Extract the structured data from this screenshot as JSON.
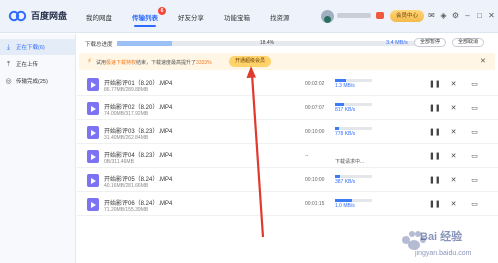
{
  "app": {
    "name": "百度网盘"
  },
  "nav": {
    "tabs": [
      {
        "label": "我的网盘"
      },
      {
        "label": "传输列表",
        "badge": "6"
      },
      {
        "label": "好友分享"
      },
      {
        "label": "功能宝箱"
      },
      {
        "label": "找资源"
      }
    ]
  },
  "header": {
    "vip_button": "会员中心",
    "icons": [
      "mail-icon",
      "skin-icon",
      "settings-icon",
      "minimize-icon",
      "maximize-icon",
      "close-icon"
    ]
  },
  "sidebar": {
    "items": [
      {
        "label": "正在下载(6)",
        "icon": "download-icon",
        "active": true
      },
      {
        "label": "正在上传",
        "icon": "upload-icon",
        "active": false
      },
      {
        "label": "传输完成(25)",
        "icon": "check-circle-icon",
        "active": false
      }
    ]
  },
  "summary": {
    "label": "下载总进度",
    "percent_text": "18.4%",
    "progress": 0.184,
    "speed": "3.4 MB/s",
    "pause_all": "全部暂停",
    "cancel_all": "全部取消"
  },
  "banner": {
    "prefix": "试用",
    "highlight1": "极速下载特权",
    "middle": "结束，下载速度最高提升了",
    "highlight2": "3333%",
    "button": "开通超级会员"
  },
  "downloads": [
    {
      "name": "开始影评01（8.20）.MP4",
      "size": "86.77MB/289.88MB",
      "time": "00:02:02",
      "progress": 0.3,
      "status": "1.3 MB/s"
    },
    {
      "name": "开始影评02（8.20）.MP4",
      "size": "74.00MB/317.92MB",
      "time": "00:07:07",
      "progress": 0.23,
      "status": "817 KB/s"
    },
    {
      "name": "开始影评03（8.23）.MP4",
      "size": "31.40MB/262.84MB",
      "time": "00:10:00",
      "progress": 0.12,
      "status": "778 KB/s"
    },
    {
      "name": "开始影评04（8.23）.MP4",
      "size": "0B/311.46MB",
      "time": "--",
      "progress": 0,
      "status": "下载请求中..."
    },
    {
      "name": "开始影评05（8.24）.MP4",
      "size": "40.16MB/281.66MB",
      "time": "00:10:00",
      "progress": 0.14,
      "status": "387 KB/s"
    },
    {
      "name": "开始影评06（8.24）.MP4",
      "size": "71.20MB/155.39MB",
      "time": "00:01:15",
      "progress": 0.46,
      "status": "1.0 MB/s"
    }
  ],
  "watermark": {
    "text": "Bai 经验",
    "url": "jingyan.baidu.com"
  },
  "colors": {
    "accent": "#2f6bff",
    "banner_bg": "#fff6e5",
    "arrow": "#e03a2f",
    "file_icon": "#7b73f2"
  }
}
